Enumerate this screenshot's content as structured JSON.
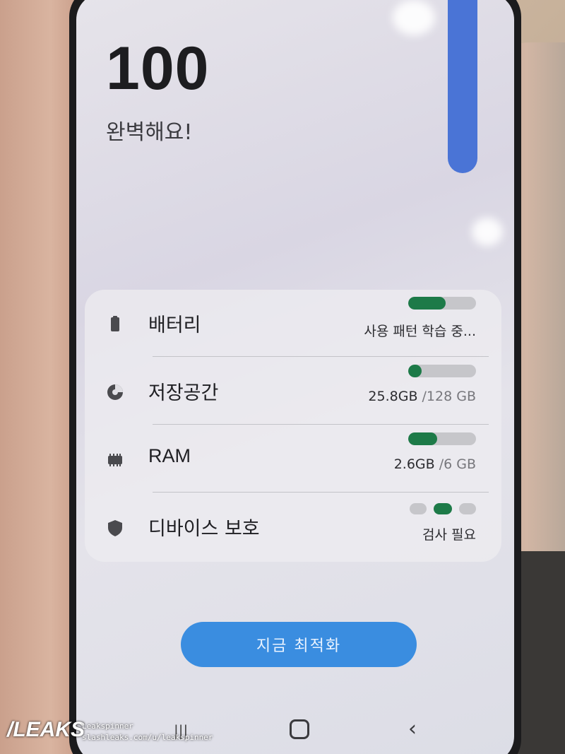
{
  "header": {
    "score": "100",
    "status": "완벽해요!"
  },
  "items": [
    {
      "label": "배터리",
      "icon": "battery-icon",
      "value": "사용 패턴 학습 중...",
      "total": "",
      "progress": 0.55
    },
    {
      "label": "저장공간",
      "icon": "storage-pie-icon",
      "value": "25.8GB",
      "total": " /128 GB",
      "progress": 0.2
    },
    {
      "label": "RAM",
      "icon": "ram-chip-icon",
      "value": "2.6GB",
      "total": " /6 GB",
      "progress": 0.43
    },
    {
      "label": "디바이스 보호",
      "icon": "shield-icon",
      "value": "검사 필요",
      "total": "",
      "progress": null
    }
  ],
  "optimize_button": {
    "label": "지금 최적화"
  },
  "watermark": {
    "logo": "/LEAKS",
    "line1": "Leakspinner",
    "line2": "slashleaks.com/u/leakspinner"
  },
  "colors": {
    "accent": "#3a8de0",
    "progress_fill": "#1d7a48",
    "scroll_indicator": "#4a74d6"
  }
}
